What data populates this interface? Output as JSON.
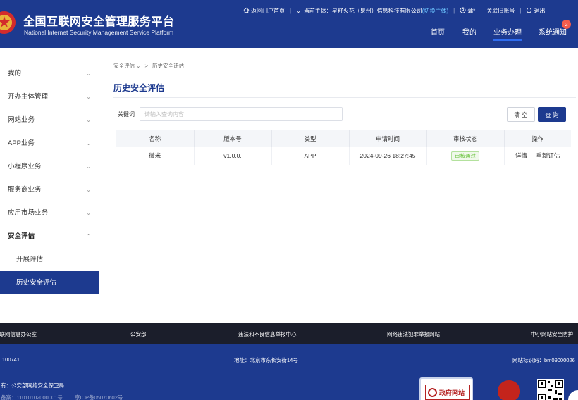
{
  "header": {
    "title_cn": "全国互联网安全管理服务平台",
    "title_en": "National Internet Security Management Service Platform",
    "topbar": {
      "back_home": "返回门户首页",
      "current_entity_label": "当前主体：",
      "current_entity_value": "星籽火花（泉州）信息科技有限公司",
      "switch_entity": "(切换主体)",
      "user_name": "蒲*",
      "link_old_account": "关联旧账号",
      "logout": "退出"
    },
    "nav": [
      "首页",
      "我的",
      "业务办理",
      "系统通知"
    ],
    "active_nav": "业务办理",
    "notification_count": "2"
  },
  "sidebar": {
    "items": [
      {
        "label": "我的",
        "chevron": "⌄"
      },
      {
        "label": "开办主体管理",
        "chevron": "⌄"
      },
      {
        "label": "网站业务",
        "chevron": "⌄"
      },
      {
        "label": "APP业务",
        "chevron": "⌄"
      },
      {
        "label": "小程序业务",
        "chevron": "⌄"
      },
      {
        "label": "服务商业务",
        "chevron": "⌄"
      },
      {
        "label": "应用市场业务",
        "chevron": "⌄"
      },
      {
        "label": "安全评估",
        "chevron": "⌃"
      }
    ],
    "sub_items": [
      {
        "label": "开展评估"
      },
      {
        "label": "历史安全评估"
      }
    ]
  },
  "breadcrumb": {
    "parent": "安全评估",
    "parent_chevron": "⌄",
    "separator": ">",
    "current": "历史安全评估"
  },
  "page_title": "历史安全评估",
  "search": {
    "label": "关键词",
    "placeholder": "请输入查询内容",
    "clear_label": "清 空",
    "search_label": "查 询"
  },
  "table": {
    "headers": [
      "名称",
      "版本号",
      "类型",
      "申请时间",
      "审核状态",
      "操作"
    ],
    "rows": [
      {
        "name": "微米",
        "version": "v1.0.0.",
        "type": "APP",
        "apply_time": "2024-09-26 18:27:45",
        "status": "审核通过",
        "actions": [
          "详情",
          "重新评估"
        ]
      }
    ]
  },
  "footer": {
    "links": [
      "互联网信息办公室",
      "公安部",
      "违法和不良信息举报中心",
      "网络违法犯罪举报网站",
      "中小网站安全防护"
    ],
    "postcode": "100741",
    "address": "地址：北京市东长安街14号",
    "site_id": "网站标识码：bm09000026",
    "sponsor": "有：公安部网络安全保卫局",
    "icp_text": "备案：11010102000001号",
    "icp2_text": "京ICP备05070602号",
    "gov_badge": "政府网站",
    "colors": {
      "header_bg": "#1d3a8f",
      "footer_dark": "#1b1e2b",
      "status_green": "#67c23a"
    }
  }
}
